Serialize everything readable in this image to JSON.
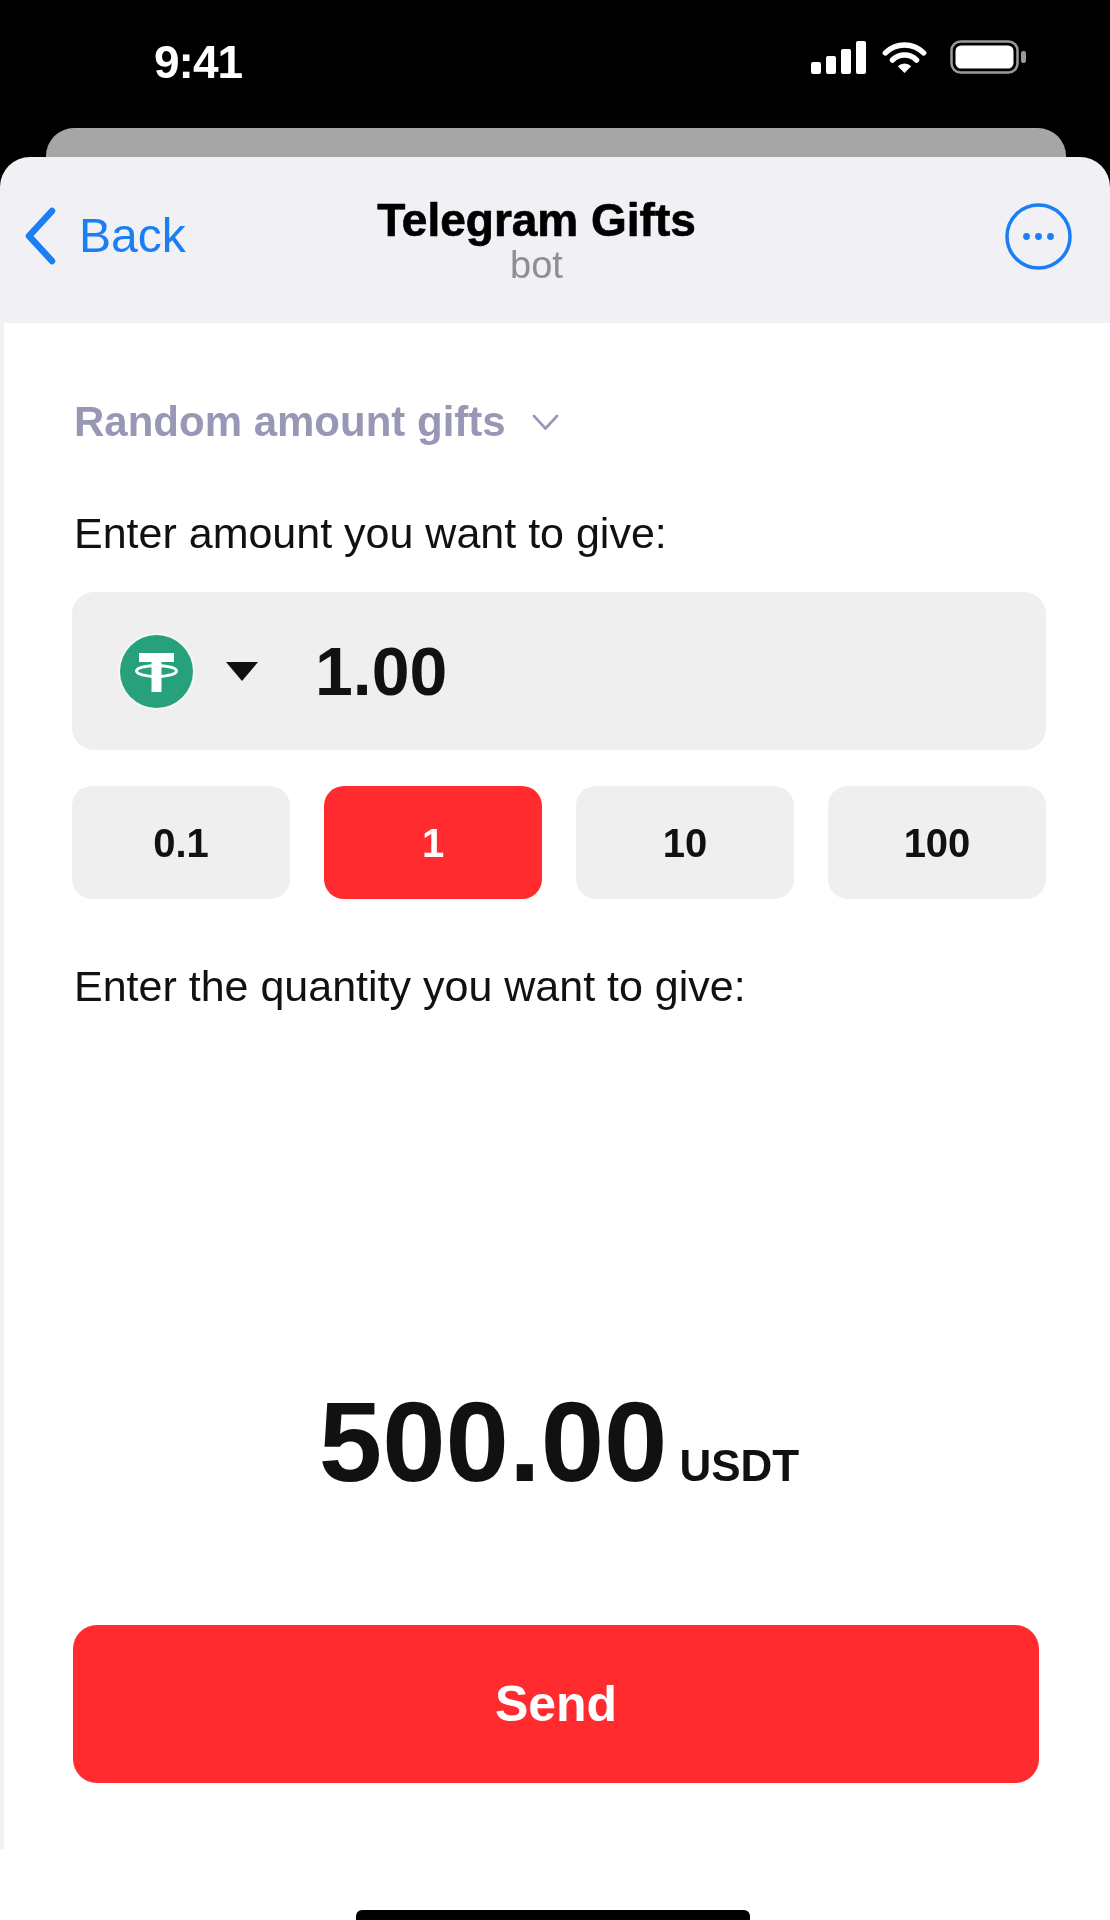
{
  "status_bar": {
    "time": "9:41"
  },
  "header": {
    "back": "Back",
    "title": "Telegram Gifts",
    "subtitle": "bot"
  },
  "mode_selector": {
    "label": "Random amount gifts"
  },
  "amount": {
    "label": "Enter amount you want to give:",
    "value": "1.00"
  },
  "presets": [
    {
      "label": "0.1",
      "selected": false
    },
    {
      "label": "1",
      "selected": true
    },
    {
      "label": "10",
      "selected": false
    },
    {
      "label": "100",
      "selected": false
    }
  ],
  "quantity": {
    "label": "Enter the quantity you want to give:"
  },
  "total": {
    "amount": "500.00",
    "currency": "USDT"
  },
  "send_button": {
    "label": "Send"
  }
}
